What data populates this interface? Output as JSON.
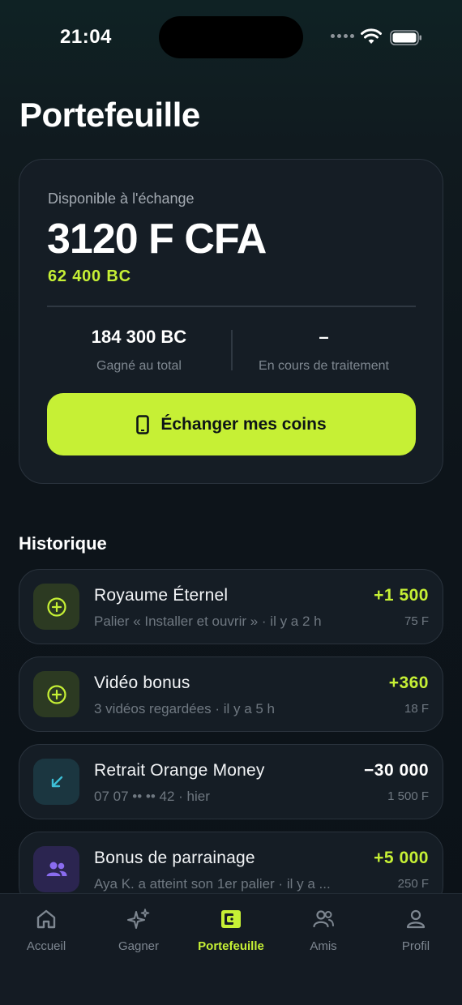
{
  "status_bar": {
    "time": "21:04"
  },
  "page": {
    "title": "Portefeuille"
  },
  "balance": {
    "label": "Disponible à l'échange",
    "amount": "3120 F CFA",
    "coins": "62 400 BC",
    "stats": [
      {
        "value": "184 300 BC",
        "label": "Gagné au total"
      },
      {
        "value": "–",
        "label": "En cours de traitement"
      }
    ],
    "exchange_button": "Échanger mes coins"
  },
  "history": {
    "title": "Historique",
    "items": [
      {
        "icon": "plus-circle-icon",
        "title": "Royaume Éternel",
        "subtitle": "Palier « Installer et ouvrir » · il y a 2 h",
        "amount": "+1 500",
        "fiat": "75 F",
        "type": "credit"
      },
      {
        "icon": "plus-circle-icon",
        "title": "Vidéo bonus",
        "subtitle": "3 vidéos regardées · il y a 5 h",
        "amount": "+360",
        "fiat": "18 F",
        "type": "credit"
      },
      {
        "icon": "arrow-down-left-icon",
        "title": "Retrait Orange Money",
        "subtitle": "07 07 •• •• 42 · hier",
        "amount": "−30 000",
        "fiat": "1 500 F",
        "type": "debit"
      },
      {
        "icon": "users-icon",
        "title": "Bonus de parrainage",
        "subtitle": "Aya K. a atteint son 1er palier · il y a ...",
        "amount": "+5 000",
        "fiat": "250 F",
        "type": "credit"
      }
    ]
  },
  "tabs": [
    {
      "label": "Accueil",
      "icon": "home-icon",
      "active": false
    },
    {
      "label": "Gagner",
      "icon": "sparkles-icon",
      "active": false
    },
    {
      "label": "Portefeuille",
      "icon": "wallet-icon",
      "active": true
    },
    {
      "label": "Amis",
      "icon": "users-icon",
      "active": false
    },
    {
      "label": "Profil",
      "icon": "user-icon",
      "active": false
    }
  ],
  "colors": {
    "accent": "#c6f035",
    "credit": "#c6f035",
    "debit": "#ffffff",
    "card_bg": "#151d25",
    "debit_icon": "#3dbfd6",
    "referral_icon": "#8a6cf0"
  }
}
